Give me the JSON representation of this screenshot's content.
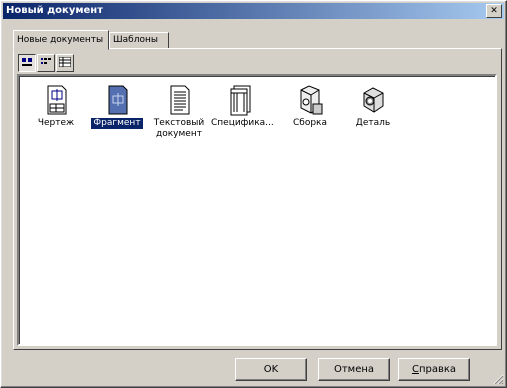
{
  "window": {
    "title": "Новый документ",
    "close_label": "✕"
  },
  "tabs": [
    {
      "label": "Новые документы",
      "active": true
    },
    {
      "label": "Шаблоны",
      "active": false
    }
  ],
  "items": [
    {
      "label": "Чертеж",
      "icon": "drawing-icon",
      "selected": false
    },
    {
      "label": "Фрагмент",
      "icon": "fragment-icon",
      "selected": true
    },
    {
      "label": "Текстовый документ",
      "icon": "text-document-icon",
      "selected": false
    },
    {
      "label": "Специфика...",
      "icon": "specification-icon",
      "selected": false
    },
    {
      "label": "Сборка",
      "icon": "assembly-icon",
      "selected": false
    },
    {
      "label": "Деталь",
      "icon": "part-icon",
      "selected": false
    }
  ],
  "buttons": {
    "ok": "OK",
    "cancel": "Отмена",
    "help_first": "С",
    "help_rest": "правка"
  },
  "colors": {
    "titlebar": "#0a246a",
    "face": "#d4d0c8",
    "selection": "#0a246a"
  }
}
